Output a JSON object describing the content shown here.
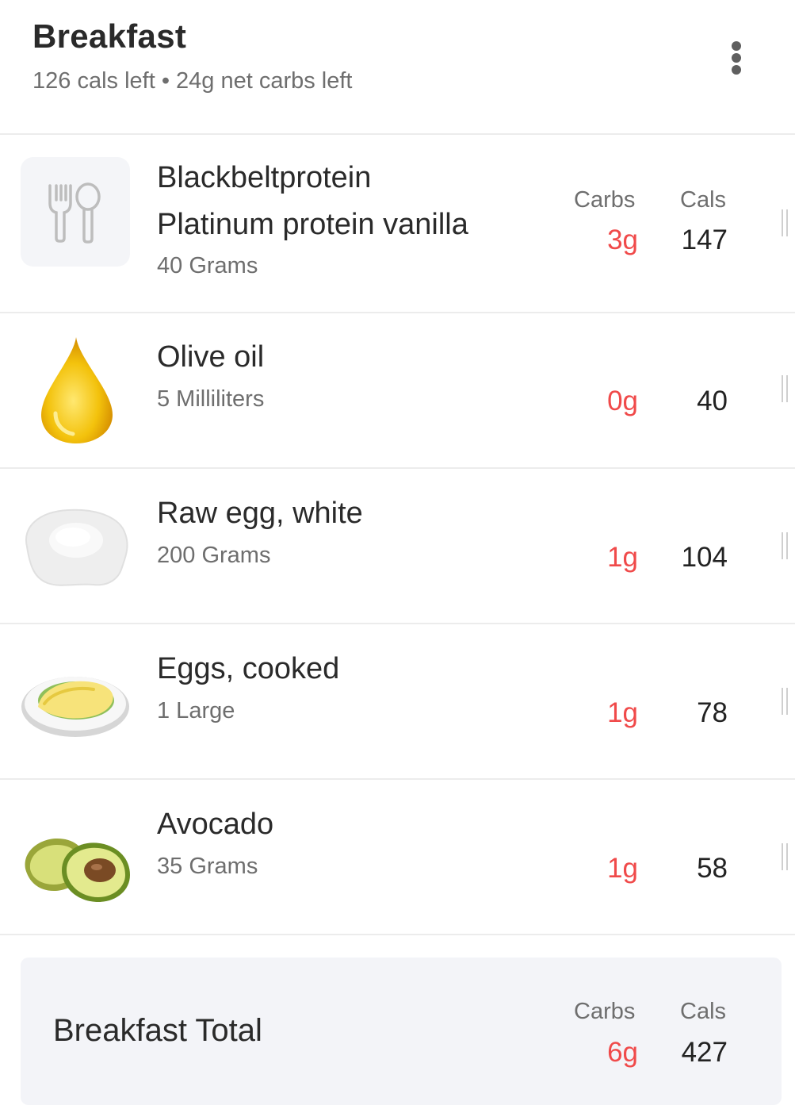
{
  "header": {
    "title": "Breakfast",
    "subtitle": "126 cals left • 24g net carbs left",
    "menu_icon": "more-vertical-icon"
  },
  "columns": {
    "carbs": "Carbs",
    "cals": "Cals"
  },
  "items": [
    {
      "name_line1": "Blackbeltprotein",
      "name_line2": "Platinum protein vanilla",
      "quantity": "40 Grams",
      "carbs": "3g",
      "cals": "147",
      "icon": "fork-spoon-icon"
    },
    {
      "name_line1": "Olive oil",
      "quantity": "5 Milliliters",
      "carbs": "0g",
      "cals": "40",
      "icon": "oil-drop-icon"
    },
    {
      "name_line1": "Raw egg, white",
      "quantity": "200 Grams",
      "carbs": "1g",
      "cals": "104",
      "icon": "egg-white-icon"
    },
    {
      "name_line1": "Eggs, cooked",
      "quantity": "1 Large",
      "carbs": "1g",
      "cals": "78",
      "icon": "cooked-egg-plate-icon"
    },
    {
      "name_line1": "Avocado",
      "quantity": "35 Grams",
      "carbs": "1g",
      "cals": "58",
      "icon": "avocado-icon"
    }
  ],
  "total": {
    "label": "Breakfast Total",
    "carbs": "6g",
    "cals": "427"
  },
  "colors": {
    "carbs": "#f04a4a",
    "divider": "#ececec",
    "total_bg": "#f3f4f8"
  }
}
